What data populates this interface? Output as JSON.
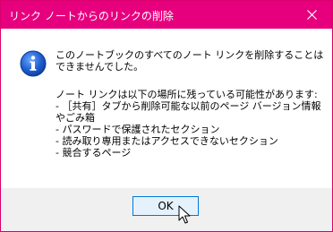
{
  "window": {
    "title": "リンク ノートからのリンクの削除",
    "titlebar_color": "#e6007e",
    "close_icon": "close-icon"
  },
  "message": {
    "icon": "information-icon",
    "primary": "このノートブックのすべてのノート リンクを削除することはできませんでした。",
    "secondary_heading": "ノート リンクは以下の場所に残っている可能性があります:",
    "items": [
      "- ［共有］タブから削除可能な以前のページ バージョン情報やごみ箱",
      "- パスワードで保護されたセクション",
      "- 読み取り専用またはアクセスできないセクション",
      "- 競合するページ"
    ]
  },
  "buttons": {
    "ok_label": "OK"
  }
}
